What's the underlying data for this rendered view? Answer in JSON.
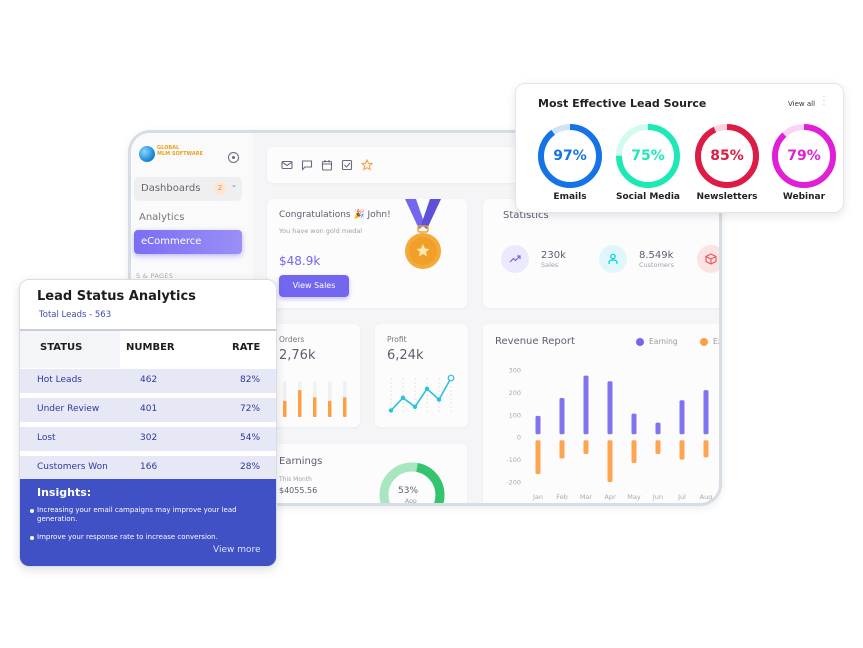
{
  "sidebar": {
    "logo_line1": "GLOBAL",
    "logo_line2": "MLM SOFTWARE",
    "dashboards_label": "Dashboards",
    "dashboards_badge": "2",
    "items": [
      {
        "label": "Analytics"
      },
      {
        "label": "eCommerce"
      }
    ],
    "section_label": "S & PAGES"
  },
  "toolbar": {
    "icons": [
      "mail-icon",
      "chat-icon",
      "calendar-icon",
      "checkbox-icon",
      "star-icon"
    ]
  },
  "congrats": {
    "title": "Congratulations 🎉 John!",
    "subtitle": "You have won gold medal",
    "amount": "$48.9k",
    "button": "View Sales"
  },
  "statistics": {
    "title": "Statistics",
    "items": [
      {
        "value": "230k",
        "label": "Sales",
        "icon": "trending-up-icon",
        "color": "#7367f0",
        "bg": "#ebe9fd"
      },
      {
        "value": "8.549k",
        "label": "Customers",
        "icon": "user-icon",
        "color": "#00cfe8",
        "bg": "#dff7fb"
      },
      {
        "value": "",
        "label": "",
        "icon": "box-icon",
        "color": "#ea5455",
        "bg": "#fbe3e3"
      }
    ]
  },
  "orders": {
    "title": "Orders",
    "value": "2,76k",
    "bars": [
      0.45,
      0.75,
      0.55,
      0.45,
      0.55
    ],
    "color": "#ff9f43"
  },
  "profit": {
    "title": "Profit",
    "value": "6,24k",
    "points": [
      0.1,
      0.45,
      0.2,
      0.7,
      0.4,
      1.0
    ],
    "color": "#28c3d7"
  },
  "earnings": {
    "title": "Earnings",
    "subtitle": "This Month",
    "value": "$4055.56",
    "donut_pct": "53%",
    "donut_label": "App",
    "donut_fraction": 0.53
  },
  "revenue": {
    "title": "Revenue Report",
    "legend": [
      {
        "label": "Earning",
        "color": "#7367f0"
      },
      {
        "label": "Ex",
        "color": "#ff9f43"
      }
    ]
  },
  "chart_data": {
    "type": "bar",
    "title": "Revenue Report",
    "categories": [
      "Jan",
      "Feb",
      "Mar",
      "Apr",
      "May",
      "Jun",
      "Jul",
      "Aug"
    ],
    "series": [
      {
        "name": "Earning",
        "values": [
          95,
          175,
          275,
          250,
          105,
          65,
          165,
          210
        ]
      },
      {
        "name": "Expense",
        "values": [
          -165,
          -95,
          -75,
          -200,
          -115,
          -75,
          -100,
          -90
        ]
      }
    ],
    "yticks": [
      300,
      200,
      100,
      0,
      -100,
      -200
    ],
    "ylim": [
      -200,
      300
    ],
    "xlabel": "",
    "ylabel": "",
    "legend_position": "top-right"
  },
  "lead_source": {
    "title": "Most Effective Lead Source",
    "view_all": "View all",
    "items": [
      {
        "label": "Emails",
        "pct": "97%",
        "fraction": 0.9,
        "color": "#1673e6",
        "track": "#cfe4fb"
      },
      {
        "label": "Social Media",
        "pct": "75%",
        "fraction": 0.75,
        "color": "#1de9b6",
        "track": "#d2fbf0"
      },
      {
        "label": "Newsletters",
        "pct": "85%",
        "fraction": 0.93,
        "color": "#dc1c45",
        "track": "#fbd3dd"
      },
      {
        "label": "Webinar",
        "pct": "79%",
        "fraction": 0.88,
        "color": "#e020d6",
        "track": "#f9d4f6"
      }
    ]
  },
  "lead_status": {
    "title": "Lead Status Analytics",
    "total": "Total Leads - 563",
    "headers": [
      "STATUS",
      "NUMBER",
      "RATE"
    ],
    "rows": [
      {
        "status": "Hot Leads",
        "number": "462",
        "rate": "82%"
      },
      {
        "status": "Under Review",
        "number": "401",
        "rate": "72%"
      },
      {
        "status": "Lost",
        "number": "302",
        "rate": "54%"
      },
      {
        "status": "Customers Won",
        "number": "166",
        "rate": "28%"
      }
    ],
    "insights_title": "Insights:",
    "insights": [
      "Increasing your email campaigns may improve your lead generation.",
      "Improve your response rate to increase conversion."
    ],
    "view_more": "View more"
  }
}
